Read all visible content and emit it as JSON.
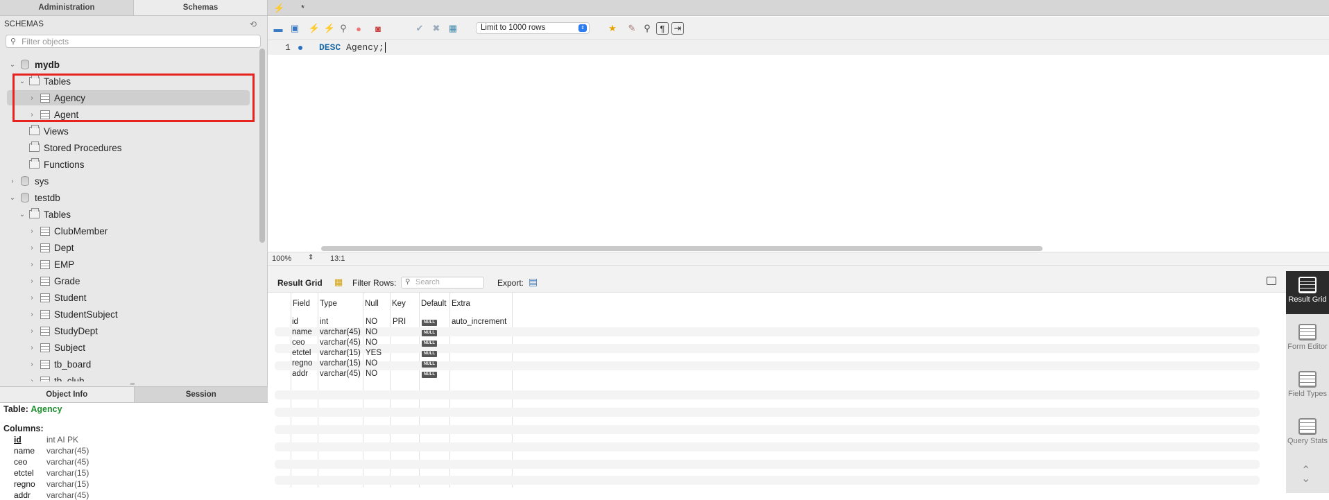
{
  "left": {
    "top_tabs": [
      "Administration",
      "Schemas"
    ],
    "schemas_header": "SCHEMAS",
    "filter_placeholder": "Filter objects",
    "tree": {
      "mydb": "mydb",
      "mydb_tables": "Tables",
      "mydb_agency": "Agency",
      "mydb_agent": "Agent",
      "mydb_views": "Views",
      "mydb_procs": "Stored Procedures",
      "mydb_funcs": "Functions",
      "sys": "sys",
      "testdb": "testdb",
      "testdb_tables": "Tables",
      "t1": "ClubMember",
      "t2": "Dept",
      "t3": "EMP",
      "t4": "Grade",
      "t5": "Student",
      "t6": "StudentSubject",
      "t7": "StudyDept",
      "t8": "Subject",
      "t9": "tb_board",
      "t10": "tb_club"
    },
    "bottom_tabs": [
      "Object Info",
      "Session"
    ],
    "info": {
      "table_label": "Table:",
      "table_name": "Agency",
      "columns_label": "Columns:",
      "columns": [
        {
          "name": "id",
          "type": "int AI PK"
        },
        {
          "name": "name",
          "type": "varchar(45)"
        },
        {
          "name": "ceo",
          "type": "varchar(45)"
        },
        {
          "name": "etctel",
          "type": "varchar(15)"
        },
        {
          "name": "regno",
          "type": "varchar(15)"
        },
        {
          "name": "addr",
          "type": "varchar(45)"
        }
      ]
    }
  },
  "editor": {
    "tab_lightning": "⚡",
    "tab_modified": "*",
    "limit_select": "Limit to 1000 rows",
    "line_number": "1",
    "keyword": "DESC",
    "rest": " Agency;",
    "zoom": "100%",
    "cursor_pos": "13:1"
  },
  "result": {
    "title": "Result Grid",
    "filter_label": "Filter Rows:",
    "search_placeholder": "Search",
    "export_label": "Export:",
    "headers": [
      "Field",
      "Type",
      "Null",
      "Key",
      "Default",
      "Extra"
    ],
    "null_badge": "NULL",
    "rows": [
      [
        "id",
        "int",
        "NO",
        "PRI",
        "NULL",
        "auto_increment"
      ],
      [
        "name",
        "varchar(45)",
        "NO",
        "",
        "NULL",
        ""
      ],
      [
        "ceo",
        "varchar(45)",
        "NO",
        "",
        "NULL",
        ""
      ],
      [
        "etctel",
        "varchar(15)",
        "YES",
        "",
        "NULL",
        ""
      ],
      [
        "regno",
        "varchar(15)",
        "NO",
        "",
        "NULL",
        ""
      ],
      [
        "addr",
        "varchar(45)",
        "NO",
        "",
        "NULL",
        ""
      ]
    ]
  },
  "side_buttons": {
    "result_grid": "Result Grid",
    "form_editor": "Form Editor",
    "field_types": "Field Types",
    "query_stats": "Query Stats"
  }
}
